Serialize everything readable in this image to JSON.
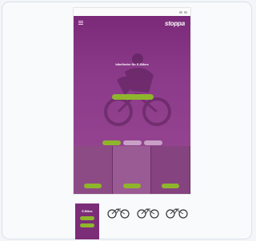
{
  "hero": {
    "logo": "stoppa",
    "logo_sub": "",
    "title": "bikefinder für E-Bikes",
    "subtitle": "",
    "cta_label": ""
  },
  "cookie": {
    "heading": "",
    "text": "",
    "buttons": [
      "",
      "",
      ""
    ]
  },
  "tiles": [
    {
      "title": "",
      "text": "",
      "button": ""
    },
    {
      "title": "",
      "text": "",
      "button": ""
    },
    {
      "title": "",
      "text": "",
      "button": ""
    }
  ],
  "lower": {
    "panel_title": "E-Bikes",
    "panel_buttons": [
      "",
      ""
    ],
    "bikes": [
      {
        "label": "",
        "price": ""
      },
      {
        "label": "",
        "price": ""
      },
      {
        "label": "",
        "price": ""
      }
    ]
  },
  "colors": {
    "primary": "#7b2d78",
    "accent": "#8fb52c"
  }
}
